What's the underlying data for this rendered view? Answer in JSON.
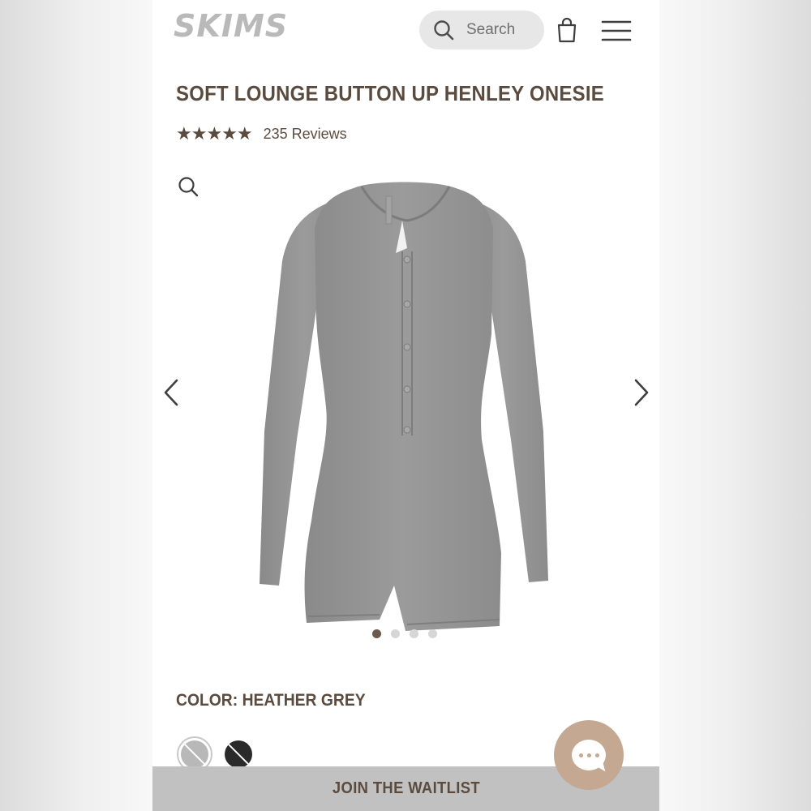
{
  "header": {
    "logo": "SKIMS",
    "search_label": "Search",
    "icons": [
      "search-icon",
      "shopping-bag-icon",
      "hamburger-menu-icon"
    ]
  },
  "product": {
    "title": "SOFT LOUNGE BUTTON UP HENLEY ONESIE",
    "rating": 5,
    "reviews_label": "235 Reviews",
    "image_count": 4,
    "active_image": 1,
    "color_label": "COLOR: HEATHER GREY",
    "swatches": [
      {
        "color": "#b8b8b8",
        "selected": true
      },
      {
        "color": "#2a2a2a",
        "selected": false
      }
    ]
  },
  "footer": {
    "waitlist_label": "JOIN THE WAITLIST"
  },
  "colors": {
    "brand_text": "#5b4b3f",
    "chat_button": "#c4a891",
    "waitlist_bar": "#c1c1c1"
  }
}
